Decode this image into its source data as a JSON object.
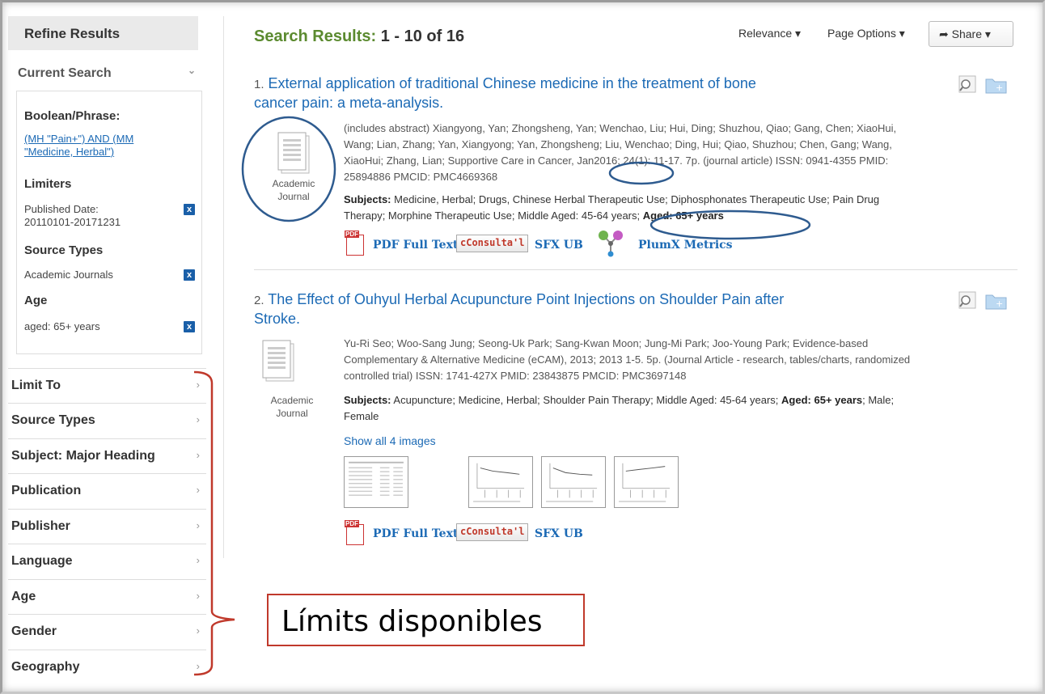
{
  "sidebar": {
    "refine_title": "Refine Results",
    "current_search": "Current Search",
    "boolean_label": "Boolean/Phrase:",
    "boolean_query_line1": "(MH \"Pain+\") AND (MM",
    "boolean_query_line2": "\"Medicine, Herbal\")",
    "limiters_label": "Limiters",
    "published_date_label": "Published Date:",
    "published_date_value": "20110101-20171231",
    "source_types_label": "Source Types",
    "source_types_value": "Academic Journals",
    "age_label": "Age",
    "age_value": "aged: 65+ years",
    "remove_symbol": "x",
    "facets": [
      "Limit To",
      "Source Types",
      "Subject: Major Heading",
      "Publication",
      "Publisher",
      "Language",
      "Age",
      "Gender",
      "Geography"
    ]
  },
  "header": {
    "results_prefix": "Search Results:",
    "results_count": "1 - 10 of 16",
    "relevance": "Relevance ▾",
    "page_options": "Page Options ▾",
    "share": "Share ▾"
  },
  "results": [
    {
      "num": "1.",
      "title_line1": "External application of traditional Chinese medicine in the treatment of bone",
      "title_line2": "cancer pain: a meta-analysis.",
      "type_line1": "Academic",
      "type_line2": "Journal",
      "meta_lines": [
        "(includes abstract) Xiangyong, Yan; Zhongsheng, Yan; Wenchao, Liu; Hui, Ding; Shuzhou, Qiao; Gang, Chen; XiaoHui,",
        "Wang; Lian, Zhang; Yan, Xiangyong; Yan, Zhongsheng; Liu, Wenchao; Ding, Hui; Qiao, Shuzhou; Chen, Gang; Wang,",
        "XiaoHui; Zhang, Lian; Supportive Care in Cancer, Jan2016; 24(1): 11-17. 7p. (journal article) ISSN: 0941-4355 PMID:",
        "25894886 PMCID: PMC4669368"
      ],
      "subjects_label": "Subjects:",
      "subjects_line1": "Medicine, Herbal; Drugs, Chinese Herbal Therapeutic Use; Diphosphonates Therapeutic Use; Pain Drug",
      "subjects_line2": "Therapy; Morphine Therapeutic Use; Middle Aged: 45-64 years;",
      "subjects_bold_tail": "Aged: 65+ years",
      "pdf": "PDF Full Text",
      "consulta": "Consulta'l",
      "sfx": "SFX UB",
      "plumx": "PlumX Metrics"
    },
    {
      "num": "2.",
      "title_line1": "The Effect of Ouhyul Herbal Acupuncture Point Injections on Shoulder Pain after",
      "title_line2": "Stroke.",
      "type_line1": "Academic",
      "type_line2": "Journal",
      "meta_lines": [
        "Yu-Ri Seo; Woo-Sang Jung; Seong-Uk Park; Sang-Kwan Moon; Jung-Mi Park; Joo-Young Park; Evidence-based",
        "Complementary & Alternative Medicine (eCAM), 2013; 2013 1-5. 5p. (Journal Article - research, tables/charts, randomized",
        "controlled trial) ISSN: 1741-427X PMID: 23843875 PMCID: PMC3697148"
      ],
      "subjects_label": "Subjects:",
      "subjects_line1a": "Acupuncture; Medicine, Herbal; Shoulder Pain Therapy; Middle Aged: 45-64 years;",
      "subjects_bold_mid": "Aged: 65+ years",
      "subjects_line1b": "; Male;",
      "subjects_line2": "Female",
      "show_images": "Show all 4 images",
      "pdf": "PDF Full Text",
      "consulta": "Consulta'l",
      "sfx": "SFX UB"
    }
  ],
  "annotation": {
    "label": "Límits disponibles",
    "color": "#c0392b",
    "circle_color": "#2e5b8f"
  }
}
